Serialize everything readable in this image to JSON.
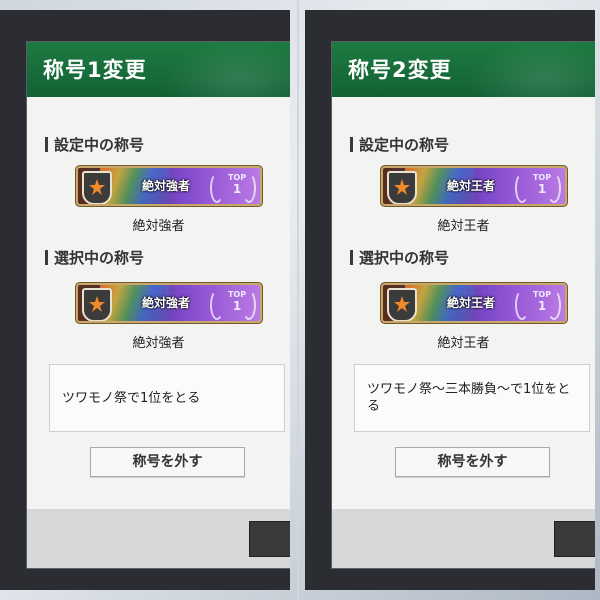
{
  "panels": [
    {
      "title": "称号1変更",
      "current_label": "設定中の称号",
      "current_badge": {
        "text": "絶対強者",
        "rank_label": "TOP",
        "rank_num": "1"
      },
      "current_name": "絶対強者",
      "selected_label": "選択中の称号",
      "selected_badge": {
        "text": "絶対強者",
        "rank_label": "TOP",
        "rank_num": "1"
      },
      "selected_name": "絶対強者",
      "description": "ツワモノ祭で1位をとる",
      "remove_button": "称号を外す"
    },
    {
      "title": "称号2変更",
      "current_label": "設定中の称号",
      "current_badge": {
        "text": "絶対王者",
        "rank_label": "TOP",
        "rank_num": "1"
      },
      "current_name": "絶対王者",
      "selected_label": "選択中の称号",
      "selected_badge": {
        "text": "絶対王者",
        "rank_label": "TOP",
        "rank_num": "1"
      },
      "selected_name": "絶対王者",
      "description": "ツワモノ祭〜三本勝負〜で1位をとる",
      "remove_button": "称号を外す"
    }
  ],
  "icons": {
    "badge_emblem": "winged-shield-icon",
    "laurel": "laurel-icon"
  },
  "colors": {
    "header_green": "#1d7a41",
    "badge_border": "#c9a96b"
  }
}
